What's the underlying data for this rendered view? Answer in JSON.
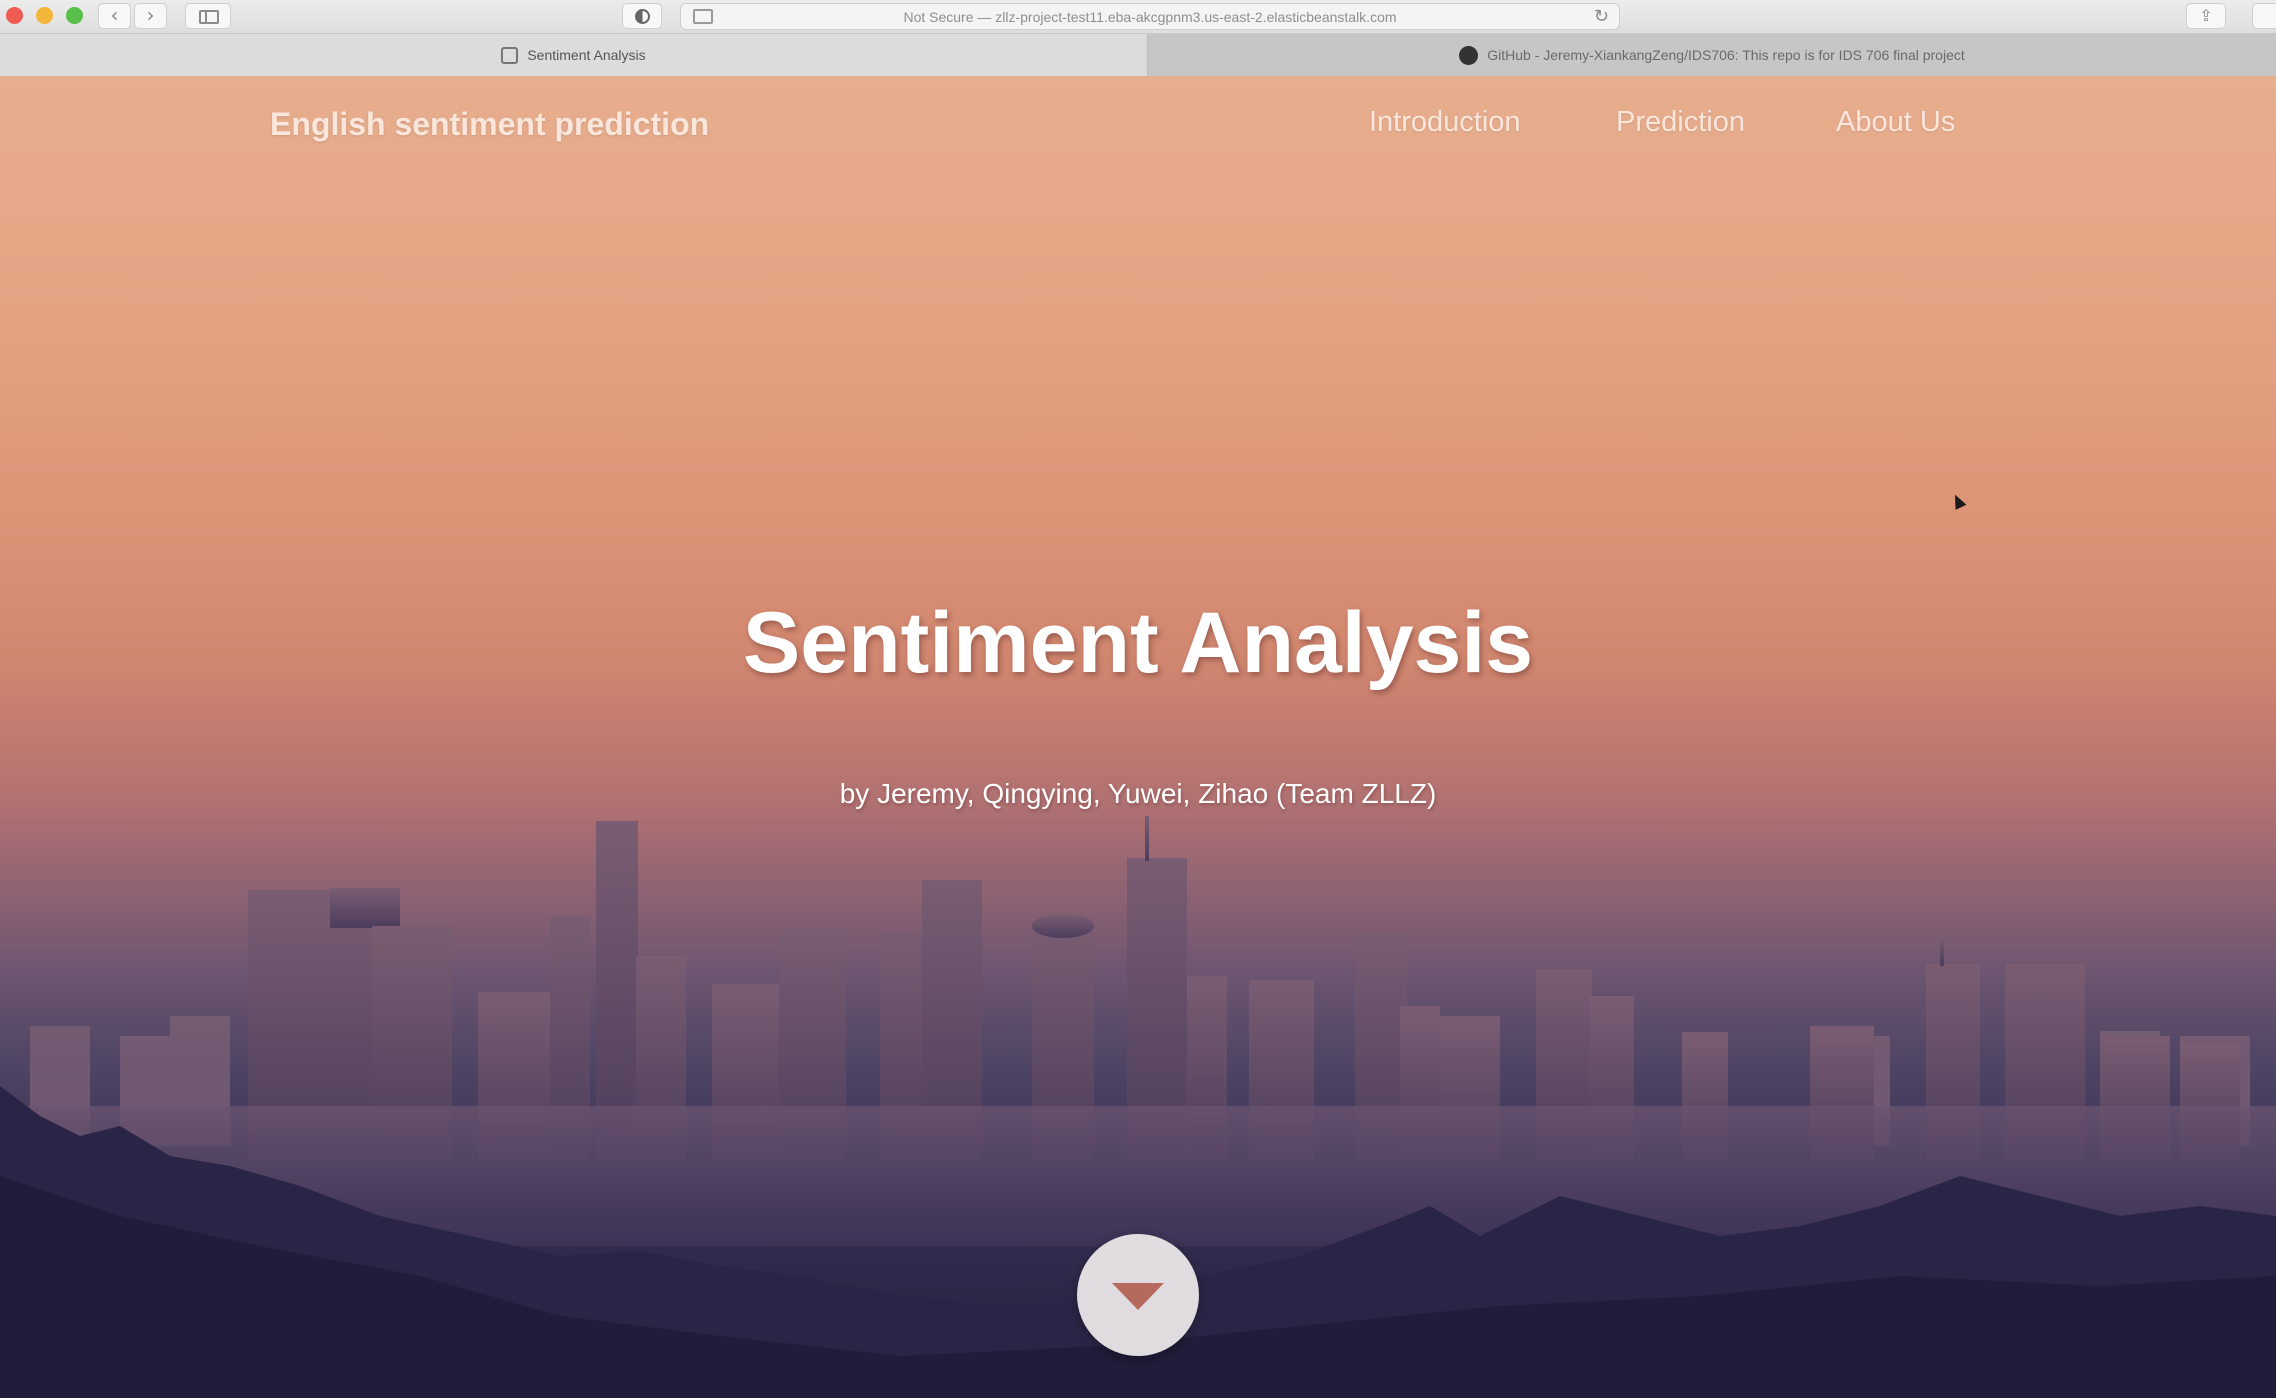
{
  "browser": {
    "address": "Not Secure — zllz-project-test11.eba-akcgpnm3.us-east-2.elasticbeanstalk.com",
    "tabs": [
      {
        "label": "Sentiment Analysis",
        "active": true
      },
      {
        "label": "GitHub - Jeremy-XiankangZeng/IDS706: This repo is for IDS 706 final project",
        "active": false
      }
    ]
  },
  "site": {
    "brand": "English sentiment prediction",
    "nav": [
      "Introduction",
      "Prediction",
      "About Us"
    ]
  },
  "hero": {
    "title": "Sentiment Analysis",
    "subtitle": "by Jeremy, Qingying, Yuwei, Zihao (Team ZLLZ)"
  },
  "icons": {
    "back": "chevron-left-icon",
    "forward": "chevron-right-icon",
    "sidebar": "sidebar-icon",
    "reader": "contrast-icon",
    "reload": "reload-icon",
    "share": "share-icon",
    "scroll": "caret-down-icon",
    "github": "github-icon"
  },
  "colors": {
    "sky_top": "#e6ae8e",
    "sky_mid": "#d1876f",
    "city": "#5a4a6e",
    "hills": "#231f3d",
    "scroll_button": "#eeeaeb",
    "scroll_arrow": "#b46b5e"
  }
}
